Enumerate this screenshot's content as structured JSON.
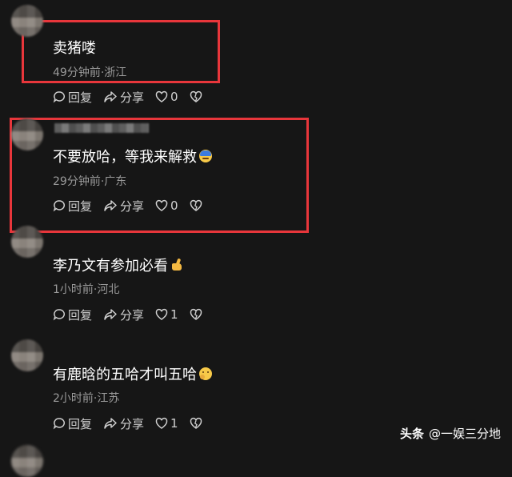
{
  "comments": [
    {
      "text": "卖猪喽",
      "meta": "49分钟前·浙江",
      "reply": "回复",
      "share": "分享",
      "likes": "0",
      "emoji": ""
    },
    {
      "text": "不要放哈，等我来解救",
      "meta": "29分钟前·广东",
      "reply": "回复",
      "share": "分享",
      "likes": "0",
      "emoji": "face-blue"
    },
    {
      "text": "李乃文有参加必看",
      "meta": "1小时前·河北",
      "reply": "回复",
      "share": "分享",
      "likes": "1",
      "emoji": "thumbs-up"
    },
    {
      "text": "有鹿晗的五哈才叫五哈",
      "meta": "2小时前·江苏",
      "reply": "回复",
      "share": "分享",
      "likes": "1",
      "emoji": "thinking-face"
    }
  ],
  "watermark": {
    "brand": "头条",
    "handle": "@一娱三分地"
  },
  "colors": {
    "background": "#161616",
    "highlight_box": "#e8363b",
    "meta_text": "#9a9a9a"
  }
}
